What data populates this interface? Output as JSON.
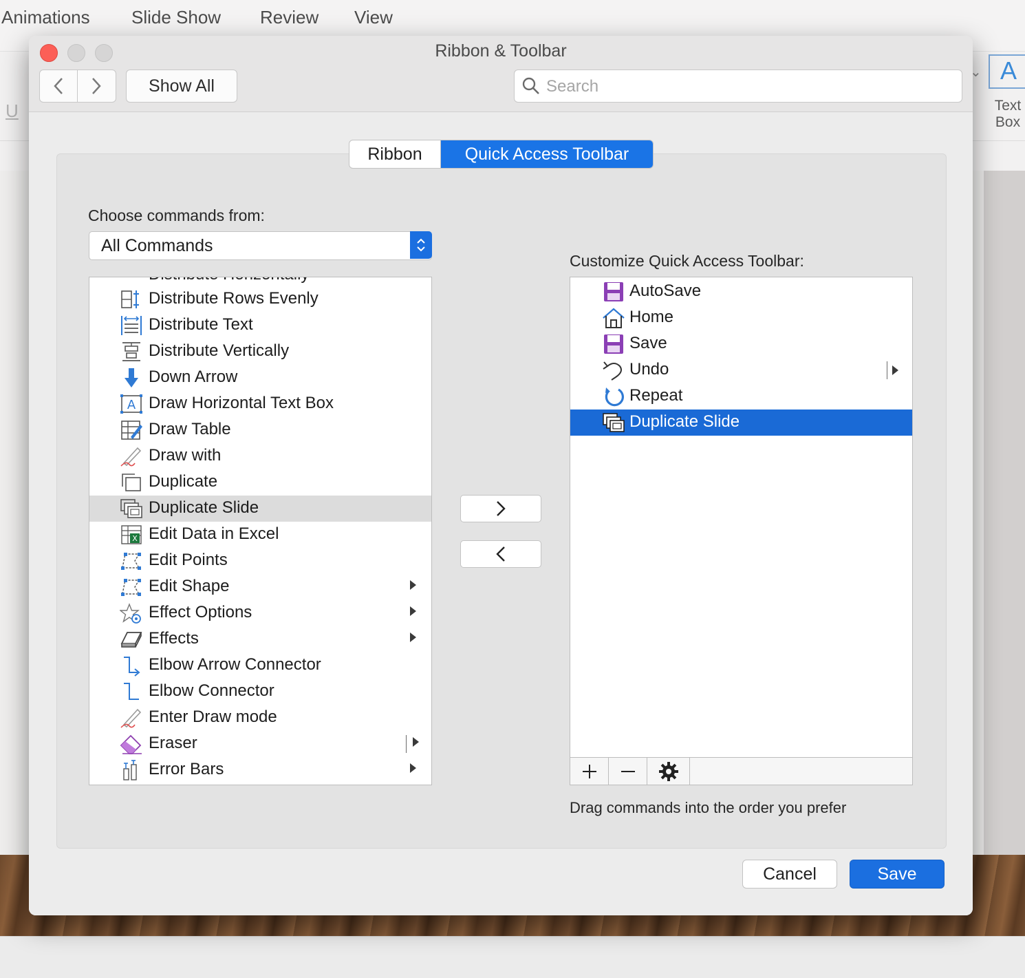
{
  "background_app": {
    "menu": [
      "Animations",
      "Slide Show",
      "Review",
      "View"
    ],
    "ribbon_textbox_label_1": "Text",
    "ribbon_textbox_label_2": "Box",
    "ribbon_textbox_glyph": "A",
    "underline_glyph": "U"
  },
  "window": {
    "title": "Ribbon & Toolbar",
    "show_all": "Show All",
    "search_placeholder": "Search"
  },
  "tabs": [
    {
      "label": "Ribbon",
      "selected": false
    },
    {
      "label": "Quick Access Toolbar",
      "selected": true
    }
  ],
  "left_panel": {
    "label": "Choose commands from:",
    "dropdown_value": "All Commands",
    "partial_item": "Distribute Horizontally",
    "items": [
      {
        "label": "Distribute Rows Evenly",
        "icon": "distribute-rows-icon",
        "submenu": false
      },
      {
        "label": "Distribute Text",
        "icon": "distribute-text-icon",
        "submenu": false
      },
      {
        "label": "Distribute Vertically",
        "icon": "distribute-vertically-icon",
        "submenu": false
      },
      {
        "label": "Down Arrow",
        "icon": "down-arrow-icon",
        "submenu": false
      },
      {
        "label": "Draw Horizontal Text Box",
        "icon": "text-box-icon",
        "submenu": false
      },
      {
        "label": "Draw Table",
        "icon": "draw-table-icon",
        "submenu": false
      },
      {
        "label": "Draw with",
        "icon": "pen-icon",
        "submenu": false
      },
      {
        "label": "Duplicate",
        "icon": "duplicate-icon",
        "submenu": false
      },
      {
        "label": "Duplicate Slide",
        "icon": "duplicate-slide-icon",
        "submenu": false,
        "highlighted": true
      },
      {
        "label": "Edit Data in Excel",
        "icon": "excel-icon",
        "submenu": false
      },
      {
        "label": "Edit Points",
        "icon": "edit-points-icon",
        "submenu": false
      },
      {
        "label": "Edit Shape",
        "icon": "edit-shape-icon",
        "submenu": true
      },
      {
        "label": "Effect Options",
        "icon": "effect-options-icon",
        "submenu": true
      },
      {
        "label": "Effects",
        "icon": "effects-icon",
        "submenu": true
      },
      {
        "label": "Elbow Arrow Connector",
        "icon": "elbow-arrow-icon",
        "submenu": false
      },
      {
        "label": "Elbow Connector",
        "icon": "elbow-connector-icon",
        "submenu": false
      },
      {
        "label": "Enter Draw mode",
        "icon": "pen-icon",
        "submenu": false
      },
      {
        "label": "Eraser",
        "icon": "eraser-icon",
        "submenu": true,
        "split": true
      },
      {
        "label": "Error Bars",
        "icon": "error-bars-icon",
        "submenu": true
      }
    ]
  },
  "right_panel": {
    "label": "Customize Quick Access Toolbar:",
    "items": [
      {
        "label": "AutoSave",
        "icon": "floppy-icon"
      },
      {
        "label": "Home",
        "icon": "home-icon"
      },
      {
        "label": "Save",
        "icon": "floppy-icon"
      },
      {
        "label": "Undo",
        "icon": "undo-icon",
        "split": true
      },
      {
        "label": "Repeat",
        "icon": "repeat-icon"
      },
      {
        "label": "Duplicate Slide",
        "icon": "duplicate-slide-icon",
        "selected": true
      }
    ],
    "hint": "Drag commands into the order you prefer"
  },
  "footer": {
    "cancel": "Cancel",
    "save": "Save"
  },
  "colors": {
    "accent": "#1a74e6",
    "selection": "#1a6ad6",
    "close": "#fc5f57"
  }
}
